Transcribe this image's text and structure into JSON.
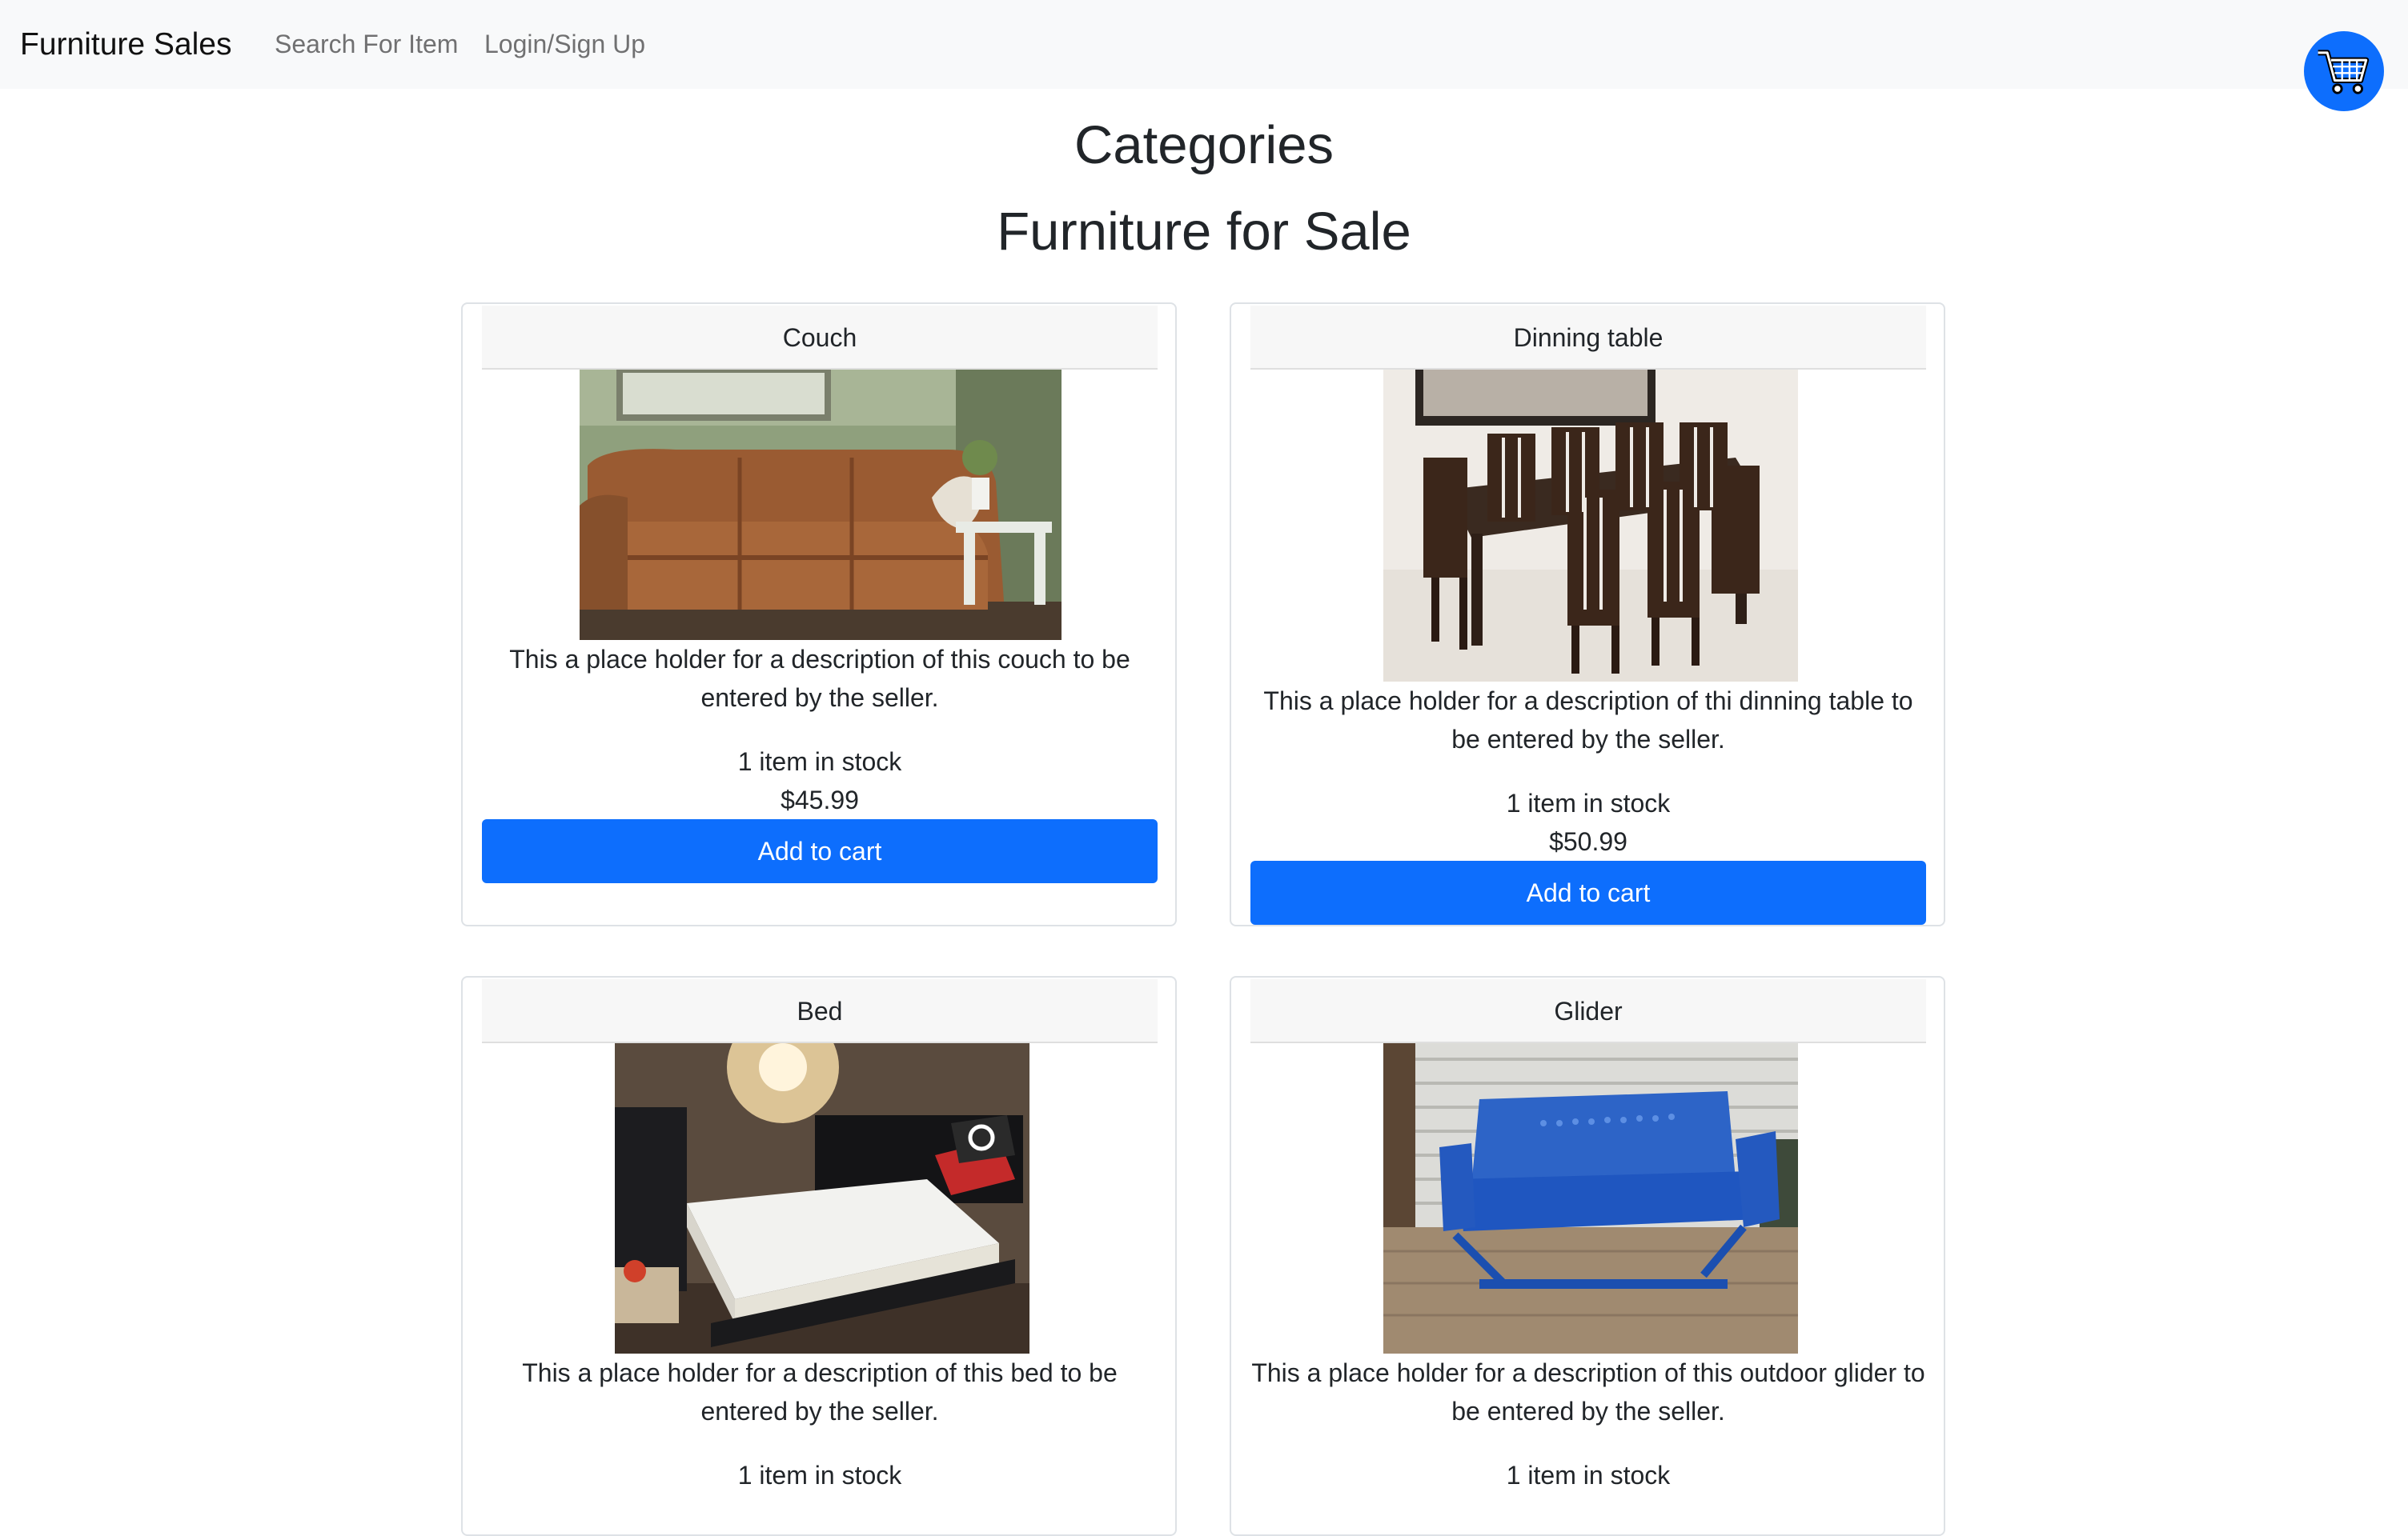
{
  "navbar": {
    "brand": "Furniture Sales",
    "links": [
      "Search For Item",
      "Login/Sign Up"
    ],
    "cart_icon": "shopping-cart-icon"
  },
  "headings": {
    "categories": "Categories",
    "sale": "Furniture for Sale"
  },
  "colors": {
    "primary": "#0d6efd",
    "navbar_bg": "#f8f9fa",
    "card_header_bg": "#f7f7f7"
  },
  "products": [
    {
      "name": "Couch",
      "description": "This a place holder for a description of this couch to be entered by the seller.",
      "stock": "1 item in stock",
      "price": "$45.99",
      "button": "Add to cart"
    },
    {
      "name": "Dinning table",
      "description": "This a place holder for a description of thi dinning table to be entered by the seller.",
      "stock": "1 item in stock",
      "price": "$50.99",
      "button": "Add to cart"
    },
    {
      "name": "Bed",
      "description": "This a place holder for a description of this bed to be entered by the seller.",
      "stock": "1 item in stock"
    },
    {
      "name": "Glider",
      "description": "This a place holder for a description of this outdoor glider to be entered by the seller.",
      "stock": "1 item in stock"
    }
  ]
}
